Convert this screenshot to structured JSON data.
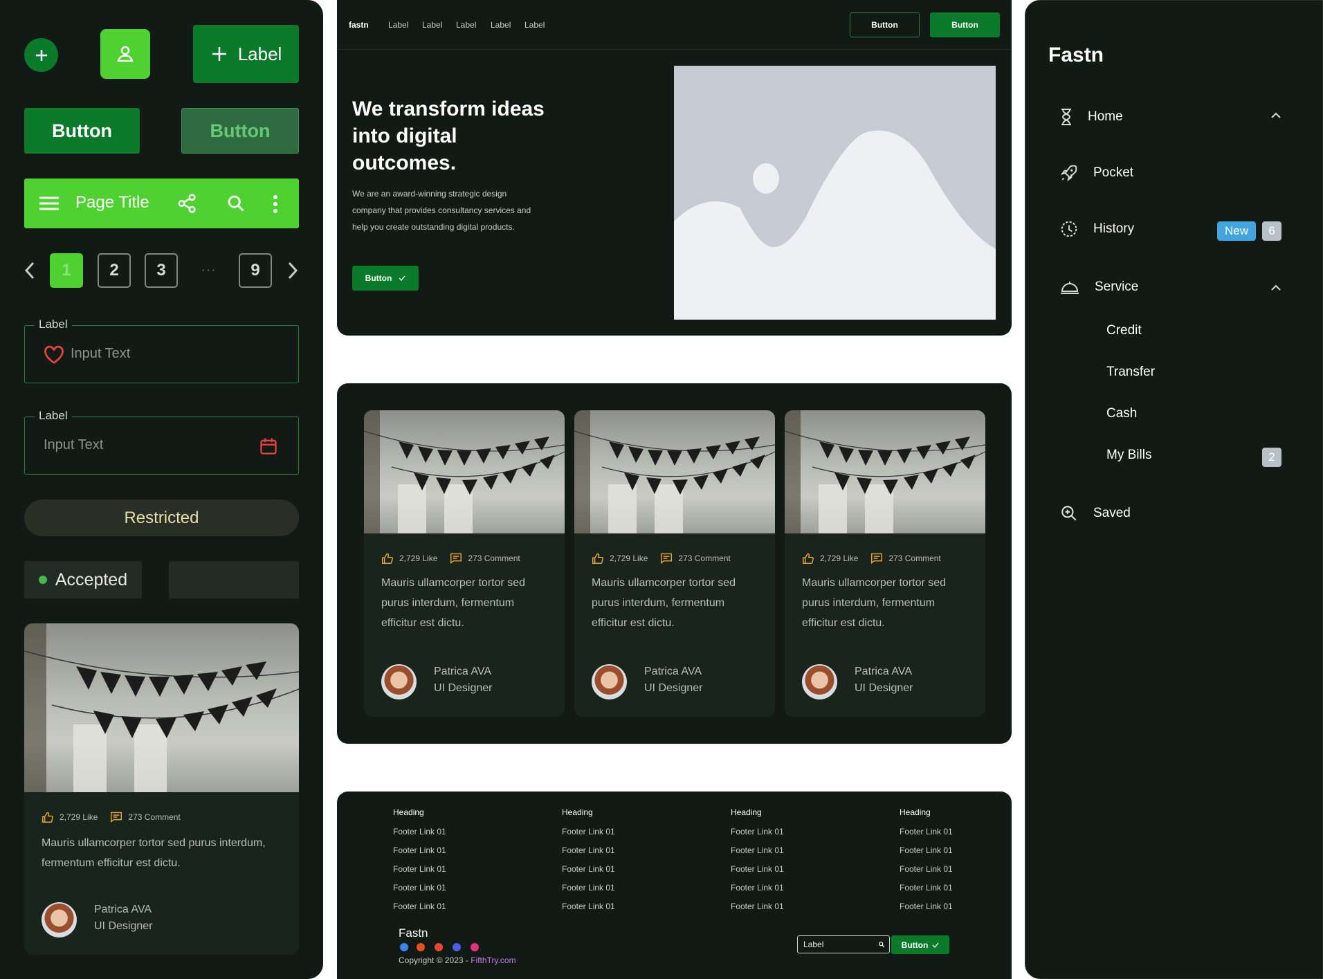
{
  "left": {
    "label_button": "Label",
    "button_primary": "Button",
    "button_secondary": "Button",
    "app_bar_title": "Page Title",
    "pagination": [
      "1",
      "2",
      "3",
      "9"
    ],
    "pagination_ellipsis": "···",
    "field1": {
      "label": "Label",
      "value": "Input Text"
    },
    "field2": {
      "label": "Label",
      "value": "Input Text"
    },
    "restricted": "Restricted",
    "accepted": "Accepted",
    "card": {
      "likes": "2,729 Like",
      "comments": "273 Comment",
      "text": "Mauris ullamcorper tortor sed purus interdum, fermentum efficitur est dictu.",
      "name": "Patrica AVA",
      "role": "UI Designer"
    }
  },
  "hero": {
    "logo": "fastn",
    "nav": [
      "Label",
      "Label",
      "Label",
      "Label",
      "Label"
    ],
    "btn_outline": "Button",
    "btn_fill": "Button",
    "headline": "We transform ideas into digital outcomes.",
    "body": "We are an award-winning strategic design company that provides consultancy services and help you create outstanding digital products.",
    "cta": "Button"
  },
  "cards": [
    {
      "likes": "2,729 Like",
      "comments": "273 Comment",
      "text": "Mauris ullamcorper tortor sed purus interdum, fermentum efficitur est dictu.",
      "name": "Patrica AVA",
      "role": "UI Designer"
    },
    {
      "likes": "2,729 Like",
      "comments": "273 Comment",
      "text": "Mauris ullamcorper tortor sed purus interdum, fermentum efficitur est dictu.",
      "name": "Patrica AVA",
      "role": "UI Designer"
    },
    {
      "likes": "2,729 Like",
      "comments": "273 Comment",
      "text": "Mauris ullamcorper tortor sed purus interdum, fermentum efficitur est dictu.",
      "name": "Patrica AVA",
      "role": "UI Designer"
    }
  ],
  "footer": {
    "columns": [
      {
        "heading": "Heading",
        "links": [
          "Footer Link 01",
          "Footer Link 01",
          "Footer Link 01",
          "Footer Link 01",
          "Footer Link 01"
        ]
      },
      {
        "heading": "Heading",
        "links": [
          "Footer Link 01",
          "Footer Link 01",
          "Footer Link 01",
          "Footer Link 01",
          "Footer Link 01"
        ]
      },
      {
        "heading": "Heading",
        "links": [
          "Footer Link 01",
          "Footer Link 01",
          "Footer Link 01",
          "Footer Link 01",
          "Footer Link 01"
        ]
      },
      {
        "heading": "Heading",
        "links": [
          "Footer Link 01",
          "Footer Link 01",
          "Footer Link 01",
          "Footer Link 01",
          "Footer Link 01"
        ]
      }
    ],
    "brand": "Fastn",
    "copyright": "Copyright © 2023 - ",
    "copyright_link": "FifthTry.com",
    "input_value": "Label",
    "button": "Button"
  },
  "side": {
    "brand": "Fastn",
    "items": {
      "home": "Home",
      "pocket": "Pocket",
      "history": "History",
      "history_badge_new": "New",
      "history_badge_count": "6",
      "service": "Service",
      "credit": "Credit",
      "transfer": "Transfer",
      "cash": "Cash",
      "my_bills": "My Bills",
      "my_bills_count": "2",
      "saved": "Saved"
    }
  },
  "colors": {
    "panel_bg": "#121a15",
    "primary_green": "#0b7a2b",
    "accent_green": "#4fd132",
    "like_icon": "#e8a436",
    "heart_icon": "#e8423b",
    "new_badge": "#42a5e0"
  },
  "icons": [
    "plus-icon",
    "user-icon",
    "menu-icon",
    "share-icon",
    "search-icon",
    "more-vertical-icon",
    "chevron-left-icon",
    "chevron-right-icon",
    "heart-icon",
    "calendar-icon",
    "thumbs-up-icon",
    "comment-icon",
    "check-icon",
    "hourglass-icon",
    "rocket-icon",
    "history-icon",
    "service-bell-icon",
    "zoom-icon",
    "chevron-up-icon"
  ]
}
